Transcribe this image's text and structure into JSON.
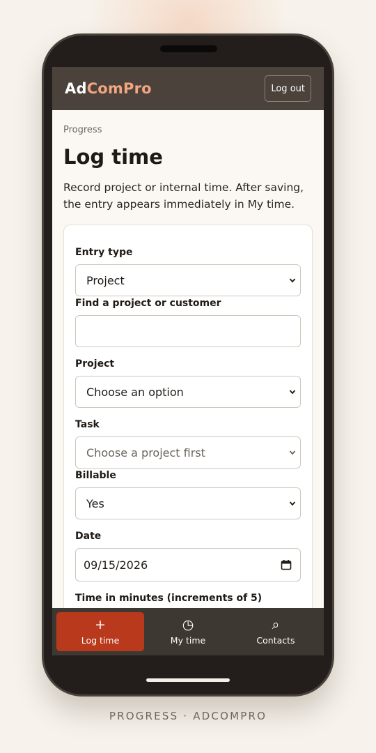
{
  "app": {
    "brand_part1": "Ad",
    "brand_part2": "ComPro",
    "logout_label": "Log out"
  },
  "page": {
    "breadcrumb": "Progress",
    "title": "Log time",
    "lead": "Record project or internal time. After saving, the entry appears immediately in My time."
  },
  "form": {
    "entry_type": {
      "label": "Entry type",
      "value": "Project"
    },
    "find": {
      "label": "Find a project or customer",
      "value": ""
    },
    "project": {
      "label": "Project",
      "value": "Choose an option"
    },
    "task": {
      "label": "Task",
      "value": "Choose a project first"
    },
    "billable": {
      "label": "Billable",
      "value": "Yes"
    },
    "date": {
      "label": "Date",
      "value": "09/15/2026"
    },
    "minutes": {
      "label": "Time in minutes (increments of 5)"
    }
  },
  "nav": [
    {
      "label": "Log time",
      "icon": "plus-icon",
      "glyph": "+"
    },
    {
      "label": "My time",
      "icon": "clock-icon",
      "glyph": "◷"
    },
    {
      "label": "Contacts",
      "icon": "search-icon",
      "glyph": "⌕"
    }
  ],
  "footer": {
    "text": "PROGRESS · ADCOMPRO"
  },
  "colors": {
    "accent": "#b8391b",
    "brand_highlight": "#f1a580",
    "topbar": "#4a423b"
  }
}
